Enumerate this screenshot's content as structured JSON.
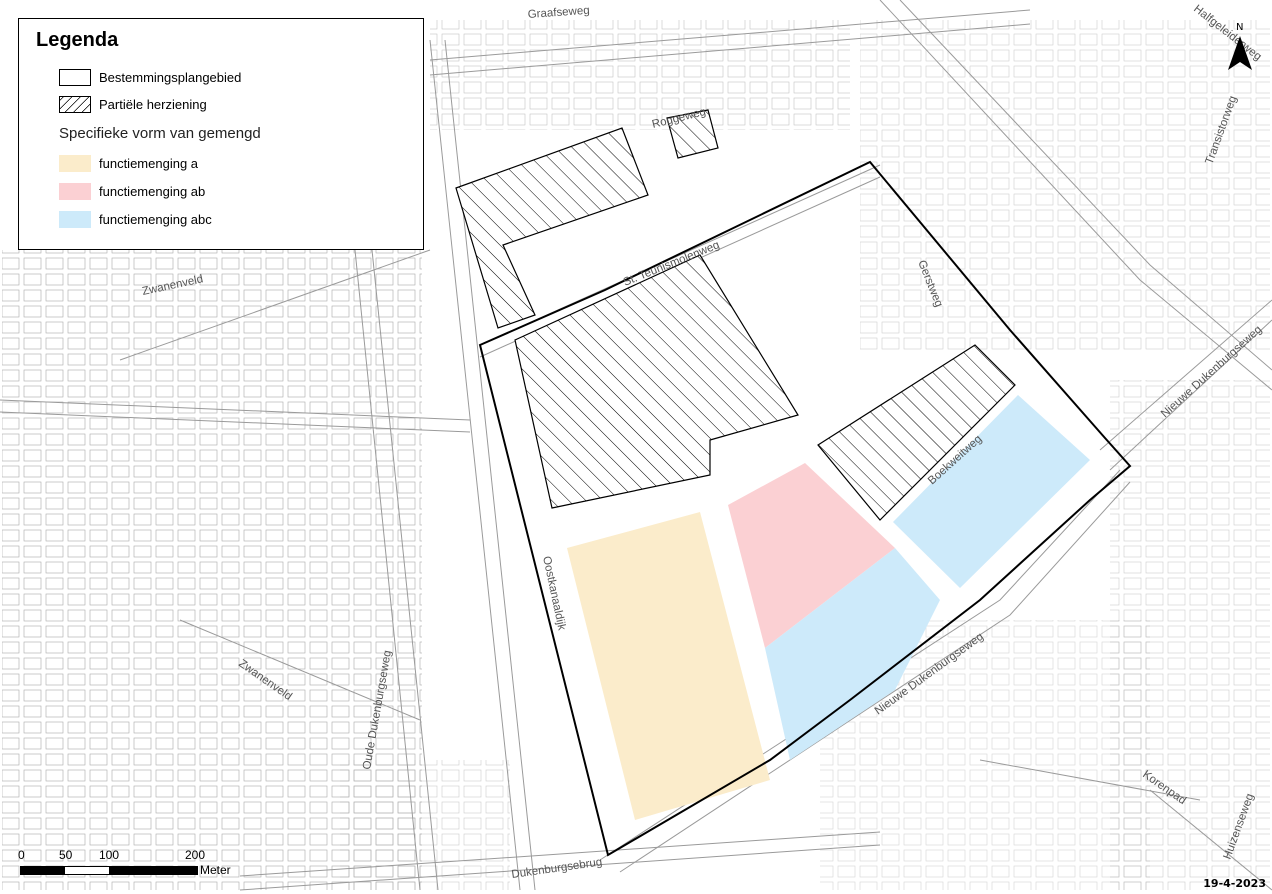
{
  "legend": {
    "title": "Legenda",
    "items": [
      {
        "label": "Bestemmingsplangebied"
      },
      {
        "label": "Partiële herziening"
      }
    ],
    "subheading": "Specifieke vorm van gemengd",
    "functions": [
      {
        "label": "functiemenging a",
        "color": "#fbeccb"
      },
      {
        "label": "functiemenging ab",
        "color": "#fbd0d3"
      },
      {
        "label": "functiemenging abc",
        "color": "#cdeafa"
      }
    ]
  },
  "streets": {
    "graafseweg": "Graafseweg",
    "roggeweg": "Roggeweg",
    "halfgeleiderweg": "Halfgeleiderweg",
    "transistorweg": "Transistorweg",
    "st_teunismolenweg": "St. Teunismolenweg",
    "gerstweg": "Gerstweg",
    "zwanenveld_1": "Zwanenveld",
    "zwanenveld_2": "Zwanenveld",
    "nieuwe_dukenburgseweg_1": "Nieuwe Dukenburgseweg",
    "nieuwe_dukenburgseweg_2": "Nieuwe Dukenburgseweg",
    "boekweitweg": "Boekweitweg",
    "oostkanaaldijk": "Oostkanaaldijk",
    "oude_dukenburgseweg": "Oude Dukenburgseweg",
    "korenpad": "Korenpad",
    "dukenburgsebrug": "Dukenburgsebrug",
    "huizenseweg": "Huizenseweg"
  },
  "north_arrow": {
    "label": "N",
    "icon": "north-arrow-icon"
  },
  "scale_bar": {
    "ticks": [
      "0",
      "50",
      "100",
      "200"
    ],
    "unit": "Meter"
  },
  "date": "19-4-2023",
  "colors": {
    "boundary": "#000000",
    "street_line": "#9a9a9a",
    "building": "#8a8a8a"
  }
}
